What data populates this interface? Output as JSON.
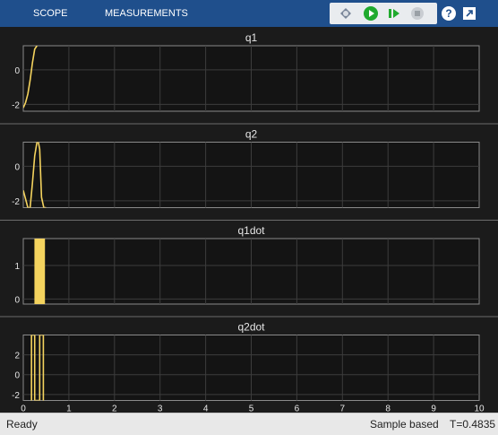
{
  "toolbar": {
    "tabs": [
      "SCOPE",
      "MEASUREMENTS"
    ],
    "icons": [
      "settings-icon",
      "run-icon",
      "step-forward-icon",
      "stop-icon",
      "help-icon",
      "undock-icon"
    ]
  },
  "colors": {
    "toolbar": "#1f4f8c",
    "plot_bg": "#141414",
    "panel_bg": "#1b1b1b",
    "grid": "#3c3c3c",
    "signal": "#f4d35e",
    "text": "#e6e6e6"
  },
  "chart_data": [
    {
      "type": "line",
      "title": "q1",
      "xlim": [
        0,
        10
      ],
      "ylim": [
        -2.4,
        1.4
      ],
      "yticks": [
        -2,
        0
      ],
      "series": [
        {
          "x": [
            0.0,
            0.05,
            0.1,
            0.15,
            0.2,
            0.25,
            0.3
          ],
          "y": [
            -2.2,
            -1.9,
            -1.4,
            -0.6,
            0.4,
            1.2,
            1.4
          ]
        }
      ]
    },
    {
      "type": "line",
      "title": "q2",
      "xlim": [
        0,
        10
      ],
      "ylim": [
        -2.4,
        1.4
      ],
      "yticks": [
        -2,
        0
      ],
      "series": [
        {
          "x": [
            0.0,
            0.05,
            0.1,
            0.15,
            0.2,
            0.25,
            0.3,
            0.33,
            0.36,
            0.4,
            0.45,
            0.5
          ],
          "y": [
            -1.4,
            -1.9,
            -2.4,
            -2.4,
            -1.0,
            0.6,
            1.4,
            1.4,
            1.0,
            -1.8,
            -2.4,
            -2.4
          ]
        }
      ]
    },
    {
      "type": "line",
      "title": "q1dot",
      "xlim": [
        0,
        10
      ],
      "ylim": [
        -0.15,
        1.8
      ],
      "yticks": [
        0,
        1
      ],
      "series": [
        {
          "x": [
            0.26,
            0.26,
            0.28,
            0.28,
            0.31,
            0.31,
            0.34,
            0.34,
            0.37,
            0.37,
            0.4,
            0.4,
            0.43,
            0.43,
            0.46,
            0.46
          ],
          "y": [
            -0.15,
            1.8,
            1.8,
            -0.15,
            -0.15,
            1.8,
            1.8,
            -0.15,
            -0.15,
            1.8,
            1.8,
            -0.15,
            -0.15,
            1.8,
            1.8,
            -0.15
          ]
        }
      ]
    },
    {
      "type": "line",
      "title": "q2dot",
      "xlim": [
        0,
        10
      ],
      "ylim": [
        -2.6,
        4.0
      ],
      "yticks": [
        -2,
        0,
        2
      ],
      "xticks": [
        0,
        1,
        2,
        3,
        4,
        5,
        6,
        7,
        8,
        9,
        10
      ],
      "series": [
        {
          "x": [
            0.18,
            0.18,
            0.25,
            0.25,
            0.36,
            0.36,
            0.44,
            0.44
          ],
          "y": [
            -2.6,
            4.0,
            4.0,
            -2.6,
            -2.6,
            4.0,
            4.0,
            -2.6
          ]
        }
      ]
    }
  ],
  "status": {
    "left": "Ready",
    "mode": "Sample based",
    "time": "T=0.4835"
  }
}
